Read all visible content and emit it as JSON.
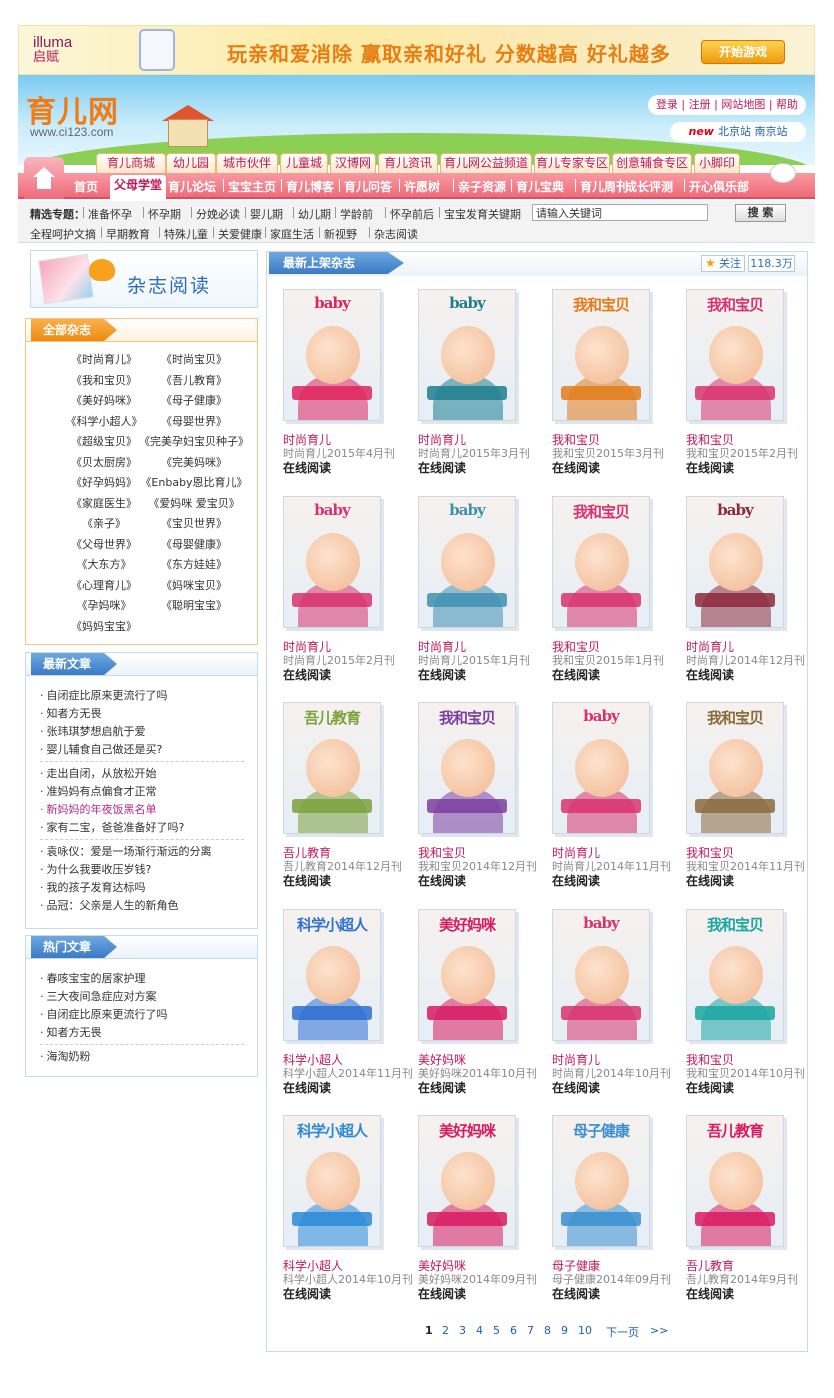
{
  "top_banner": {
    "brand": "illuma",
    "brand_sub": "启赋",
    "slogan": "玩亲和爱消除 赢取亲和好礼 分数越高 好礼越多",
    "button": "开始游戏"
  },
  "header": {
    "logo": "育儿网",
    "url": "www.ci123.com",
    "links": [
      "登录",
      "注册",
      "网站地图",
      "帮助"
    ],
    "stations": {
      "badge": "new",
      "items": [
        "北京站",
        "南京站"
      ]
    }
  },
  "category_tabs": [
    "育儿商城",
    "幼儿园",
    "城市伙伴",
    "儿童城",
    "汉博网",
    "育儿资讯",
    "育儿网公益频道",
    "育儿专家专区",
    "创意辅食专区",
    "小脚印"
  ],
  "main_nav": [
    "首页",
    "父母学堂",
    "育儿论坛",
    "宝宝主页",
    "育儿博客",
    "育儿问答",
    "许愿树",
    "亲子资源",
    "育儿宝典",
    "育儿周刊",
    "成长评测",
    "开心俱乐部"
  ],
  "topics": {
    "label": "精选专题：",
    "row1": [
      "准备怀孕",
      "怀孕期",
      "分娩必读",
      "婴儿期",
      "幼儿期",
      "学龄前",
      "怀孕前后",
      "宝宝发育关键期"
    ],
    "row2": [
      "全程呵护文摘",
      "早期教育",
      "特殊儿童",
      "关爱健康",
      "家庭生活",
      "新视野",
      "杂志阅读"
    ]
  },
  "search": {
    "placeholder": "请输入关键词",
    "value": "请输入关键词",
    "button": "搜 索"
  },
  "sidebar": {
    "banner_title": "杂志阅读",
    "all_mags_title": "全部杂志",
    "all_mags": [
      "《时尚育儿》",
      "《时尚宝贝》",
      "《我和宝贝》",
      "《吾儿教育》",
      "《美好妈咪》",
      "《母子健康》",
      "《科学小超人》",
      "《母婴世界》",
      "《超级宝贝》",
      "《完美孕妇宝贝种子》",
      "《贝太厨房》",
      "《完美妈咪》",
      "《好孕妈妈》",
      "《Enbaby恩比育儿》",
      "《家庭医生》",
      "《爱妈咪 爱宝贝》",
      "《亲子》",
      "《宝贝世界》",
      "《父母世界》",
      "《母婴健康》",
      "《大东方》",
      "《东方娃娃》",
      "《心理育儿》",
      "《妈咪宝贝》",
      "《孕妈咪》",
      "《聪明宝宝》",
      "《妈妈宝宝》"
    ],
    "news_title": "最新文章",
    "news_groups": [
      [
        "自闭症比原来更流行了吗",
        "知者方无畏",
        "张玮琪梦想启航于爱",
        "婴儿辅食自己做还是买?"
      ],
      [
        "走出自闭，从放松开始",
        "准妈妈有点偏食才正常",
        "新妈妈的年夜饭黑名单",
        "家有二宝，爸爸准备好了吗?"
      ],
      [
        "袁咏仪：爱是一场渐行渐远的分离",
        "为什么我要收压岁钱?",
        "我的孩子发育达标吗",
        "品冠：父亲是人生的新角色"
      ]
    ],
    "hot_title": "热门文章",
    "hot_groups": [
      [
        "春咳宝宝的居家护理",
        "三大夜间急症应对方案",
        "自闭症比原来更流行了吗",
        "知者方无畏"
      ],
      [
        "海淘奶粉"
      ]
    ]
  },
  "main": {
    "title": "最新上架杂志",
    "follow": "关注",
    "follow_count": "118.3万",
    "read_label": "在线阅读",
    "magazines": [
      {
        "name": "时尚育儿",
        "issue": "时尚育儿2015年4月刊",
        "mast": "baby",
        "color": "#e0245e"
      },
      {
        "name": "时尚育儿",
        "issue": "时尚育儿2015年3月刊",
        "mast": "baby",
        "color": "#1e7f8f"
      },
      {
        "name": "我和宝贝",
        "issue": "我和宝贝2015年3月刊",
        "mast": "我和宝贝",
        "color": "#e27c1a"
      },
      {
        "name": "我和宝贝",
        "issue": "我和宝贝2015年2月刊",
        "mast": "我和宝贝",
        "color": "#d8336e"
      },
      {
        "name": "时尚育儿",
        "issue": "时尚育儿2015年2月刊",
        "mast": "baby",
        "color": "#d8336e"
      },
      {
        "name": "时尚育儿",
        "issue": "时尚育儿2015年1月刊",
        "mast": "baby",
        "color": "#3f8fb0"
      },
      {
        "name": "我和宝贝",
        "issue": "我和宝贝2015年1月刊",
        "mast": "我和宝贝",
        "color": "#d8336e"
      },
      {
        "name": "时尚育儿",
        "issue": "时尚育儿2014年12月刊",
        "mast": "baby",
        "color": "#8b2a3d"
      },
      {
        "name": "吾儿教育",
        "issue": "吾儿教育2014年12月刊",
        "mast": "吾儿教育",
        "color": "#7aa13c"
      },
      {
        "name": "我和宝贝",
        "issue": "我和宝贝2014年12月刊",
        "mast": "我和宝贝",
        "color": "#7b3fa0"
      },
      {
        "name": "时尚育儿",
        "issue": "时尚育儿2014年11月刊",
        "mast": "baby",
        "color": "#d8336e"
      },
      {
        "name": "我和宝贝",
        "issue": "我和宝贝2014年11月刊",
        "mast": "我和宝贝",
        "color": "#8a6a3c"
      },
      {
        "name": "科学小超人",
        "issue": "科学小超人2014年11月刊",
        "mast": "科学小超人",
        "color": "#2e6fd1"
      },
      {
        "name": "美好妈咪",
        "issue": "美好妈咪2014年10月刊",
        "mast": "美好妈咪",
        "color": "#d81b60"
      },
      {
        "name": "时尚育儿",
        "issue": "时尚育儿2014年10月刊",
        "mast": "baby",
        "color": "#d8336e"
      },
      {
        "name": "我和宝贝",
        "issue": "我和宝贝2014年10月刊",
        "mast": "我和宝贝",
        "color": "#1aa6a0"
      },
      {
        "name": "科学小超人",
        "issue": "科学小超人2014年10月刊",
        "mast": "科学小超人",
        "color": "#2a8ad8"
      },
      {
        "name": "美好妈咪",
        "issue": "美好妈咪2014年09月刊",
        "mast": "美好妈咪",
        "color": "#d81b60"
      },
      {
        "name": "母子健康",
        "issue": "母子健康2014年09月刊",
        "mast": "母子健康",
        "color": "#3a8fd0"
      },
      {
        "name": "吾儿教育",
        "issue": "吾儿教育2014年9月刊",
        "mast": "吾儿教育",
        "color": "#d81b60"
      }
    ],
    "pager": {
      "pages": [
        "1",
        "2",
        "3",
        "4",
        "5",
        "6",
        "7",
        "8",
        "9",
        "10"
      ],
      "current": "1",
      "next": "下一页",
      "last": ">>"
    }
  }
}
